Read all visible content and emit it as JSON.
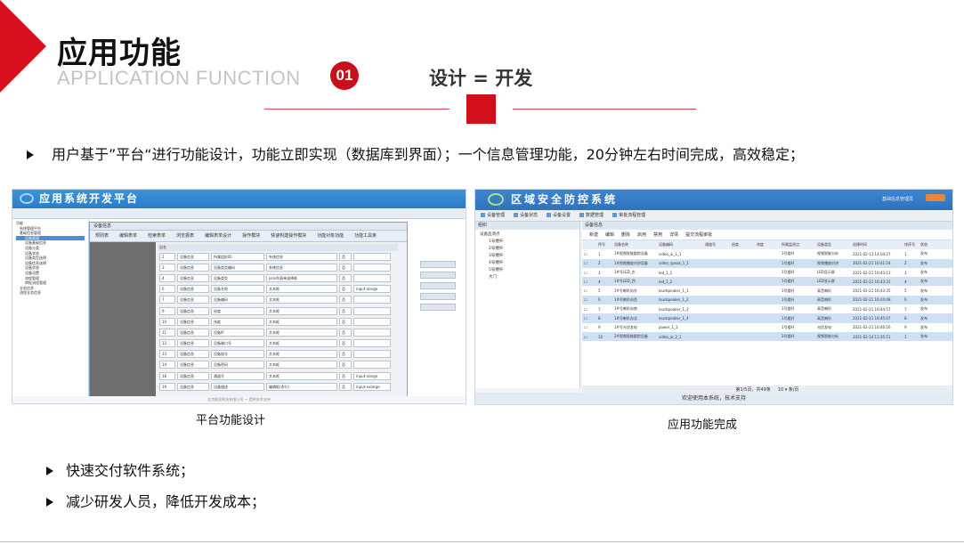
{
  "slide": {
    "title": "应用功能",
    "subtitle": "APPLICATION FUNCTION",
    "badge": "01",
    "headline": "设计 = 开发",
    "main_bullet": "用户基于”平台“进行功能设计，功能立即实现（数据库到界面）；一个信息管理功能，20分钟左右时间完成，高效稳定；",
    "bullets": [
      "快速交付软件系统；",
      "减少研发人员，降低开发成本；"
    ],
    "accent_color": "#d7101b"
  },
  "left_screenshot": {
    "caption": "平台功能设计",
    "app_title": "应用系统开发平台",
    "tree_items": [
      "功能",
      "系统管理平台",
      "基础信息管理",
      "设备管理",
      "设备基础信息",
      "设备分类",
      "设备状态",
      "设备类型选择",
      "设备信息选择",
      "设备状态",
      "设备设置",
      "流程管理",
      "审批流程管理",
      "业务信息",
      "流程业务信息"
    ],
    "tree_selected": 3,
    "dialog_title": "设备信息",
    "dialog_tabs": [
      "规则表",
      "编辑表单",
      "检索表单",
      "浏览报表",
      "编辑表单设计",
      "操作模块",
      "快速构建操作模块",
      "功能对象功能",
      "功能工具条"
    ],
    "grid_header": "自名",
    "rows": [
      {
        "n": "2",
        "a": "设备信息",
        "b": "所属组织ID",
        "c": "系统信息",
        "d": "否",
        "e": ""
      },
      {
        "n": "3",
        "a": "设备信息",
        "b": "设备类型编码",
        "c": "系统信息",
        "d": "否",
        "e": ""
      },
      {
        "n": "4",
        "a": "设备信息",
        "b": "设备类型",
        "c": "json列表单选择框",
        "d": "否",
        "e": ""
      },
      {
        "n": "6",
        "a": "设备信息",
        "b": "设备名称",
        "c": "文本框",
        "d": "否",
        "e": "input-xlarge"
      },
      {
        "n": "7",
        "a": "设备信息",
        "b": "设备编码",
        "c": "文本框",
        "d": "否",
        "e": ""
      },
      {
        "n": "9",
        "a": "设备信息",
        "b": "经度",
        "c": "文本框",
        "d": "否",
        "e": ""
      },
      {
        "n": "10",
        "a": "设备信息",
        "b": "纬度",
        "c": "文本框",
        "d": "否",
        "e": ""
      },
      {
        "n": "11",
        "a": "设备信息",
        "b": "设备IP",
        "c": "文本框",
        "d": "否",
        "e": ""
      },
      {
        "n": "12",
        "a": "设备信息",
        "b": "设备端口号",
        "c": "文本框",
        "d": "否",
        "e": ""
      },
      {
        "n": "13",
        "a": "设备信息",
        "b": "设备账号",
        "c": "文本框",
        "d": "否",
        "e": ""
      },
      {
        "n": "14",
        "a": "设备信息",
        "b": "设备密码",
        "c": "文本框",
        "d": "否",
        "e": ""
      },
      {
        "n": "18",
        "a": "设备信息",
        "b": "通道号",
        "c": "文本框",
        "d": "否",
        "e": "input-xlarge"
      },
      {
        "n": "19",
        "a": "设备信息",
        "b": "设备描述",
        "c": "编辑框(多行)",
        "d": "否",
        "e": "input-xxlarge"
      }
    ],
    "footer": "北京能双科技有限公司 — 提供技术支持"
  },
  "right_screenshot": {
    "caption": "应用功能完成",
    "app_title": "区域安全防控系统",
    "user_info": "基础信息管理员",
    "toolbar": [
      "设备管理",
      "设备状态",
      "设备设置",
      "数据管理",
      "审批流程管理"
    ],
    "tree_header": "组织",
    "tree_items": [
      "设备监测点",
      "1号楼杆",
      "2号楼杆",
      "3号楼杆",
      "4号楼杆",
      "5号楼杆",
      "大门"
    ],
    "panel_title": "设备信息",
    "actions": [
      "新建",
      "编辑",
      "删除",
      "启用",
      "禁用",
      "详情",
      "提交流程审批"
    ],
    "columns": [
      "",
      "序号",
      "设备名称",
      "设备编码",
      "通道号",
      "经度",
      "纬度",
      "所属监测点",
      "设备类型",
      "创建时间",
      "排序号",
      "状态"
    ],
    "rows": [
      [
        "1",
        "1#视频智能跟踪设备",
        "video_ai_1_1",
        "",
        "",
        "",
        "1号楼杆",
        "视频智能分析",
        "2021-02-13 14:04:27",
        "1",
        "发布"
      ],
      [
        "2",
        "1#视频播放对讲设备",
        "video_speak_1_1",
        "",
        "",
        "",
        "1号楼杆",
        "视频播放对讲",
        "2021-02-21 16:41:24",
        "2",
        "发布"
      ],
      [
        "3",
        "1#号LED_东",
        "led_1_1",
        "",
        "",
        "",
        "1号楼杆",
        "LED显示屏",
        "2021-02-21 16:43:13",
        "3",
        "发布"
      ],
      [
        "4",
        "1#号LED_西",
        "led_1_2",
        "",
        "",
        "",
        "1号楼杆",
        "LED显示屏",
        "2021-02-21 16:43:31",
        "4",
        "发布"
      ],
      [
        "5",
        "1#号喇叭向东",
        "loudspeaker_1_1",
        "",
        "",
        "",
        "1号楼杆",
        "高音喇叭",
        "2021-02-21 16:43:35",
        "5",
        "发布"
      ],
      [
        "6",
        "1#号喇叭向西",
        "loudspeaker_1_2",
        "",
        "",
        "",
        "1号楼杆",
        "高音喇叭",
        "2021-02-21 16:44:48",
        "6",
        "发布"
      ],
      [
        "7",
        "1#号喇叭向南",
        "loudspeaker_1_3",
        "",
        "",
        "",
        "1号楼杆",
        "高音喇叭",
        "2021-02-21 16:44:57",
        "7",
        "发布"
      ],
      [
        "8",
        "1#号喇叭向北",
        "loudspeaker_1_4",
        "",
        "",
        "",
        "1号楼杆",
        "高音喇叭",
        "2021-02-21 16:45:07",
        "8",
        "发布"
      ],
      [
        "9",
        "1#号光伏发电",
        "power_1_1",
        "",
        "",
        "",
        "1号楼杆",
        "光伏发电",
        "2021-02-21 16:46:16",
        "9",
        "发布"
      ],
      [
        "10",
        "2#视频智能跟踪设备",
        "video_ai_2_1",
        "",
        "",
        "",
        "2号楼杆",
        "视频智能分析",
        "2021-02-14 11:35:51",
        "1",
        "发布"
      ]
    ],
    "pager": "第1/5页，共49条",
    "page_size": "10 ▾ 条/页",
    "status_bar": "欢迎使用本系统，技术支持"
  }
}
